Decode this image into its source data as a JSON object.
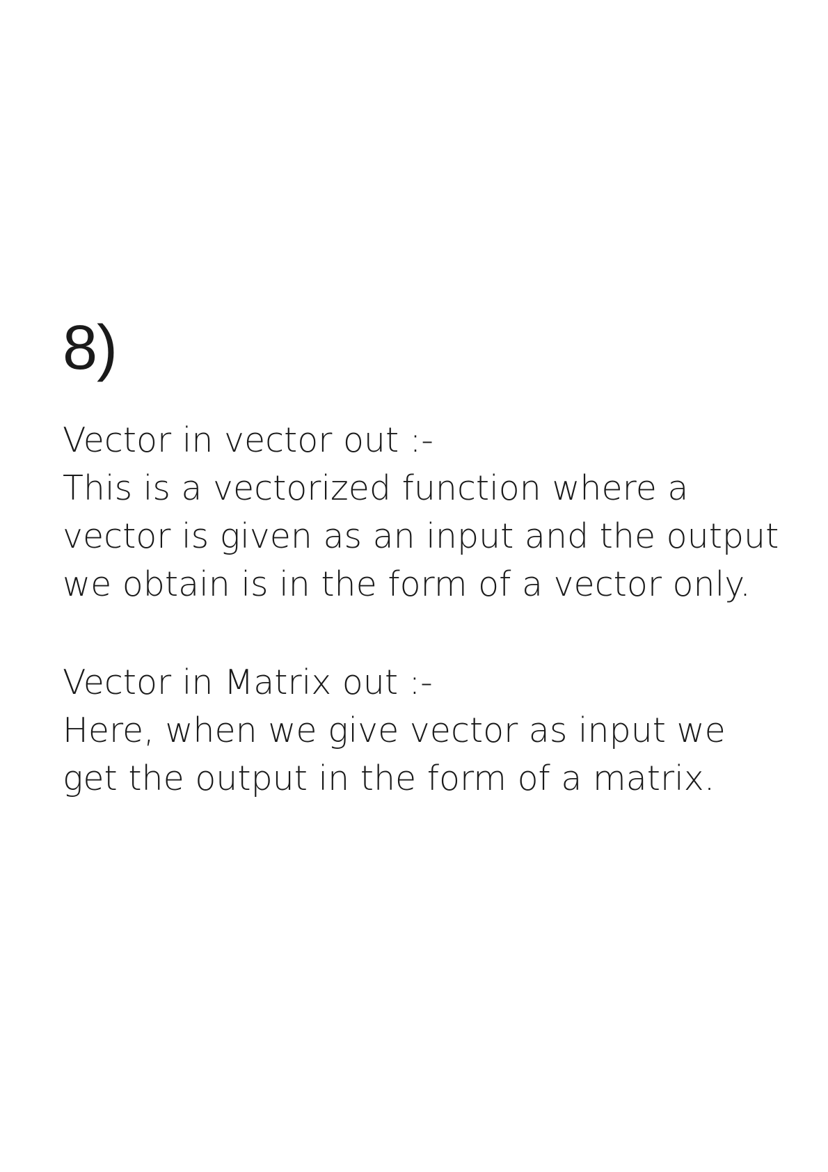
{
  "question": {
    "number": "8)"
  },
  "sections": [
    {
      "heading": "Vector in vector out :-",
      "lines": [
        "This is a vectorized function where a",
        "vector is given as an input and the output",
        "we obtain is in the form of a vector only."
      ]
    },
    {
      "heading": "Vector in Matrix out :-",
      "lines": [
        "Here, when we give vector as input we",
        "get the output in the form of a matrix."
      ]
    }
  ]
}
